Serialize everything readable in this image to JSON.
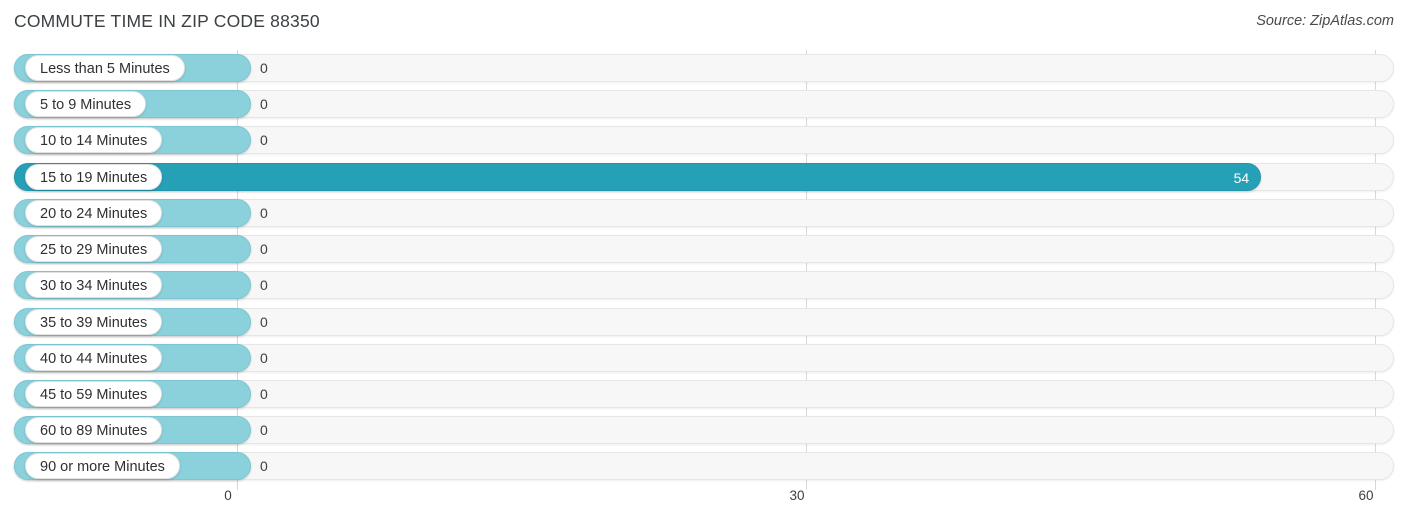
{
  "header": {
    "title": "COMMUTE TIME IN ZIP CODE 88350",
    "source": "Source: ZipAtlas.com"
  },
  "style": {
    "bar_color_light": "#8ad1dc",
    "bar_color_dark": "#26a0b7",
    "track_color": "#f7f7f7",
    "gridline_color": "#d8d8d8",
    "text_color": "#3c4043",
    "background": "#ffffff"
  },
  "chart_data": {
    "type": "bar",
    "orientation": "horizontal",
    "title": "COMMUTE TIME IN ZIP CODE 88350",
    "subtitle": "",
    "xlabel": "",
    "ylabel": "",
    "xlim": [
      0,
      60
    ],
    "grid": true,
    "gridlines": [
      0,
      30,
      60
    ],
    "xticks": [
      0,
      30,
      60
    ],
    "xtick_labels": [
      "0",
      "30",
      "60"
    ],
    "legend": false,
    "categories": [
      "Less than 5 Minutes",
      "5 to 9 Minutes",
      "10 to 14 Minutes",
      "15 to 19 Minutes",
      "20 to 24 Minutes",
      "25 to 29 Minutes",
      "30 to 34 Minutes",
      "35 to 39 Minutes",
      "40 to 44 Minutes",
      "45 to 59 Minutes",
      "60 to 89 Minutes",
      "90 or more Minutes"
    ],
    "values": [
      0,
      0,
      0,
      54,
      0,
      0,
      0,
      0,
      0,
      0,
      0,
      0
    ],
    "value_labels": [
      "0",
      "0",
      "0",
      "54",
      "0",
      "0",
      "0",
      "0",
      "0",
      "0",
      "0",
      "0"
    ],
    "highlighted_index": 3,
    "rows": [
      {
        "label": "Less than 5 Minutes",
        "value": 0,
        "value_label": "0",
        "highlight": false
      },
      {
        "label": "5 to 9 Minutes",
        "value": 0,
        "value_label": "0",
        "highlight": false
      },
      {
        "label": "10 to 14 Minutes",
        "value": 0,
        "value_label": "0",
        "highlight": false
      },
      {
        "label": "15 to 19 Minutes",
        "value": 54,
        "value_label": "54",
        "highlight": true
      },
      {
        "label": "20 to 24 Minutes",
        "value": 0,
        "value_label": "0",
        "highlight": false
      },
      {
        "label": "25 to 29 Minutes",
        "value": 0,
        "value_label": "0",
        "highlight": false
      },
      {
        "label": "30 to 34 Minutes",
        "value": 0,
        "value_label": "0",
        "highlight": false
      },
      {
        "label": "35 to 39 Minutes",
        "value": 0,
        "value_label": "0",
        "highlight": false
      },
      {
        "label": "40 to 44 Minutes",
        "value": 0,
        "value_label": "0",
        "highlight": false
      },
      {
        "label": "45 to 59 Minutes",
        "value": 0,
        "value_label": "0",
        "highlight": false
      },
      {
        "label": "60 to 89 Minutes",
        "value": 0,
        "value_label": "0",
        "highlight": false
      },
      {
        "label": "90 or more Minutes",
        "value": 0,
        "value_label": "0",
        "highlight": false
      }
    ]
  }
}
